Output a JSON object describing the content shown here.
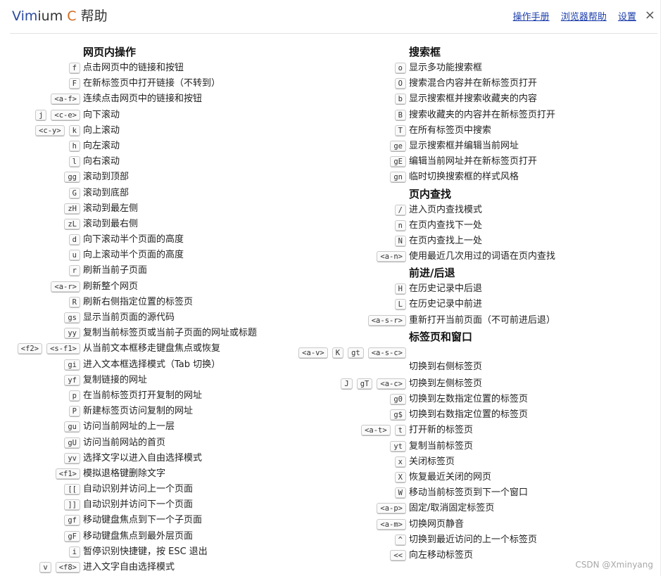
{
  "header": {
    "title_part1": "Vim",
    "title_part2": "ium ",
    "title_part3": "C",
    "title_part4": " 帮助",
    "links": [
      "操作手册",
      "浏览器帮助",
      "设置"
    ],
    "close_symbol": "×"
  },
  "left_sections": [
    {
      "title": "网页内操作",
      "items": [
        {
          "keys": [
            "f"
          ],
          "desc": "点击网页中的链接和按钮"
        },
        {
          "keys": [
            "F"
          ],
          "desc": "在新标签页中打开链接（不转到）"
        },
        {
          "keys": [
            "<a-f>"
          ],
          "desc": "连续点击网页中的链接和按钮"
        },
        {
          "keys": [
            "j",
            "<c-e>"
          ],
          "desc": "向下滚动"
        },
        {
          "keys": [
            "<c-y>",
            "k"
          ],
          "desc": "向上滚动"
        },
        {
          "keys": [
            "h"
          ],
          "desc": "向左滚动"
        },
        {
          "keys": [
            "l"
          ],
          "desc": "向右滚动"
        },
        {
          "keys": [
            "gg"
          ],
          "desc": "滚动到顶部"
        },
        {
          "keys": [
            "G"
          ],
          "desc": "滚动到底部"
        },
        {
          "keys": [
            "zH"
          ],
          "desc": "滚动到最左侧"
        },
        {
          "keys": [
            "zL"
          ],
          "desc": "滚动到最右侧"
        },
        {
          "keys": [
            "d"
          ],
          "desc": "向下滚动半个页面的高度"
        },
        {
          "keys": [
            "u"
          ],
          "desc": "向上滚动半个页面的高度"
        },
        {
          "keys": [
            "r"
          ],
          "desc": "刷新当前子页面"
        },
        {
          "keys": [
            "<a-r>"
          ],
          "desc": "刷新整个网页"
        },
        {
          "keys": [
            "R"
          ],
          "desc": "刷新右侧指定位置的标签页"
        },
        {
          "keys": [
            "gs"
          ],
          "desc": "显示当前页面的源代码"
        },
        {
          "keys": [
            "yy"
          ],
          "desc": "复制当前标签页或当前子页面的网址或标题"
        },
        {
          "keys": [
            "<f2>",
            "<s-f1>"
          ],
          "desc": "从当前文本框移走键盘焦点或恢复"
        },
        {
          "keys": [
            "gi"
          ],
          "desc": "进入文本框选择模式（Tab 切换）"
        },
        {
          "keys": [
            "yf"
          ],
          "desc": "复制链接的网址"
        },
        {
          "keys": [
            "p"
          ],
          "desc": "在当前标签页打开复制的网址"
        },
        {
          "keys": [
            "P"
          ],
          "desc": "新建标签页访问复制的网址"
        },
        {
          "keys": [
            "gu"
          ],
          "desc": "访问当前网址的上一层"
        },
        {
          "keys": [
            "gU"
          ],
          "desc": "访问当前网站的首页"
        },
        {
          "keys": [
            "yv"
          ],
          "desc": "选择文字以进入自由选择模式"
        },
        {
          "keys": [
            "<f1>"
          ],
          "desc": "模拟退格键删除文字"
        },
        {
          "keys": [
            "[["
          ],
          "desc": "自动识别并访问上一个页面"
        },
        {
          "keys": [
            "]]"
          ],
          "desc": "自动识别并访问下一个页面"
        },
        {
          "keys": [
            "gf"
          ],
          "desc": "移动键盘焦点到下一个子页面"
        },
        {
          "keys": [
            "gF"
          ],
          "desc": "移动键盘焦点到最外层页面"
        },
        {
          "keys": [
            "i"
          ],
          "desc": "暂停识别快捷键，按 ESC 退出"
        },
        {
          "keys": [
            "v",
            "<f8>"
          ],
          "desc": "进入文字自由选择模式"
        }
      ]
    }
  ],
  "right_sections": [
    {
      "title": "搜索框",
      "items": [
        {
          "keys": [
            "o"
          ],
          "desc": "显示多功能搜索框"
        },
        {
          "keys": [
            "O"
          ],
          "desc": "搜索混合内容并在新标签页打开"
        },
        {
          "keys": [
            "b"
          ],
          "desc": "显示搜索框并搜索收藏夹的内容"
        },
        {
          "keys": [
            "B"
          ],
          "desc": "搜索收藏夹的内容并在新标签页打开"
        },
        {
          "keys": [
            "T"
          ],
          "desc": "在所有标签页中搜索"
        },
        {
          "keys": [
            "ge"
          ],
          "desc": "显示搜索框并编辑当前网址"
        },
        {
          "keys": [
            "gE"
          ],
          "desc": "编辑当前网址并在新标签页打开"
        },
        {
          "keys": [
            "gn"
          ],
          "desc": "临时切换搜索框的样式风格"
        }
      ]
    },
    {
      "title": "页内查找",
      "items": [
        {
          "keys": [
            "/"
          ],
          "desc": "进入页内查找模式"
        },
        {
          "keys": [
            "n"
          ],
          "desc": "在页内查找下一处"
        },
        {
          "keys": [
            "N"
          ],
          "desc": "在页内查找上一处"
        },
        {
          "keys": [
            "<a-n>"
          ],
          "desc": "使用最近几次用过的词语在页内查找"
        }
      ]
    },
    {
      "title": "前进/后退",
      "items": [
        {
          "keys": [
            "H"
          ],
          "desc": "在历史记录中后退"
        },
        {
          "keys": [
            "L"
          ],
          "desc": "在历史记录中前进"
        },
        {
          "keys": [
            "<a-s-r>"
          ],
          "desc": "重新打开当前页面（不可前进后退）"
        }
      ]
    },
    {
      "title": "标签页和窗口",
      "items": [
        {
          "keys": [
            "<a-v>",
            "K",
            "gt",
            "<a-s-c>"
          ],
          "desc": "切换到右侧标签页",
          "multi": true
        },
        {
          "keys": [
            "J",
            "gT",
            "<a-c>"
          ],
          "desc": "切换到左侧标签页"
        },
        {
          "keys": [
            "g0"
          ],
          "desc": "切换到左数指定位置的标签页"
        },
        {
          "keys": [
            "g$"
          ],
          "desc": "切换到右数指定位置的标签页"
        },
        {
          "keys": [
            "<a-t>",
            "t"
          ],
          "desc": "打开新的标签页"
        },
        {
          "keys": [
            "yt"
          ],
          "desc": "复制当前标签页"
        },
        {
          "keys": [
            "x"
          ],
          "desc": "关闭标签页"
        },
        {
          "keys": [
            "X"
          ],
          "desc": "恢复最近关闭的网页"
        },
        {
          "keys": [
            "W"
          ],
          "desc": "移动当前标签页到下一个窗口"
        },
        {
          "keys": [
            "<a-p>"
          ],
          "desc": "固定/取消固定标签页"
        },
        {
          "keys": [
            "<a-m>"
          ],
          "desc": "切换网页静音"
        },
        {
          "keys": [
            "^"
          ],
          "desc": "切换到最近访问的上一个标签页"
        },
        {
          "keys": [
            "<<"
          ],
          "desc": "向左移动标签页"
        }
      ]
    }
  ],
  "watermark": "CSDN @Xminyang"
}
